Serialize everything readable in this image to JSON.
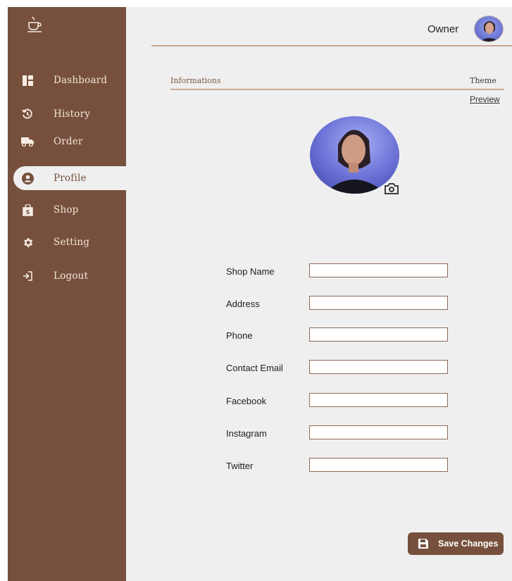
{
  "header": {
    "user_name": "Owner"
  },
  "sidebar": {
    "items": [
      {
        "label": "Dashboard",
        "icon": "dashboard-icon"
      },
      {
        "label": "History",
        "icon": "history-icon"
      },
      {
        "label": "Order",
        "icon": "truck-icon"
      },
      {
        "label": "Profile",
        "icon": "user-circle-icon",
        "active": true
      },
      {
        "label": "Shop",
        "icon": "shopping-bag-icon"
      },
      {
        "label": "Setting",
        "icon": "gear-icon"
      },
      {
        "label": "Logout",
        "icon": "logout-icon"
      }
    ]
  },
  "tabs": {
    "informations": "Informations",
    "theme": "Theme",
    "preview": "Preview"
  },
  "form": {
    "fields": [
      {
        "label": "Shop Name",
        "value": ""
      },
      {
        "label": "Address",
        "value": ""
      },
      {
        "label": "Phone",
        "value": ""
      },
      {
        "label": "Contact Email",
        "value": ""
      },
      {
        "label": "Facebook",
        "value": ""
      },
      {
        "label": "Instagram",
        "value": ""
      },
      {
        "label": "Twitter",
        "value": ""
      }
    ]
  },
  "actions": {
    "save_label": "Save Changes"
  },
  "colors": {
    "brand": "#76503c",
    "background": "#efefef",
    "divider": "#c9a891"
  }
}
